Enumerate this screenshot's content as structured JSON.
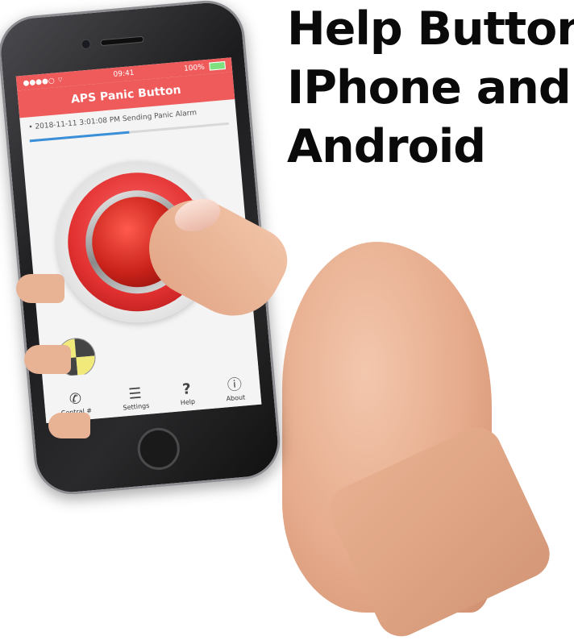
{
  "headline": {
    "line1": "Help Button",
    "line2": "IPhone and",
    "line3": "Android"
  },
  "phone_screen": {
    "status_time": "09:41",
    "battery": "100%",
    "app_title": "APS Panic Button",
    "log_entry": "• 2018-11-11 3:01:08 PM Sending Panic Alarm",
    "progress_fraction": 0.5,
    "tabs": [
      {
        "label": "Central #",
        "icon": "phone-icon"
      },
      {
        "label": "Settings",
        "icon": "sliders-icon"
      },
      {
        "label": "Help",
        "icon": "question-icon"
      },
      {
        "label": "About",
        "icon": "info-icon"
      }
    ]
  },
  "colors": {
    "app_red": "#ef5b5b",
    "panic_red": "#e23131",
    "progress_blue": "#3a8fd9"
  }
}
